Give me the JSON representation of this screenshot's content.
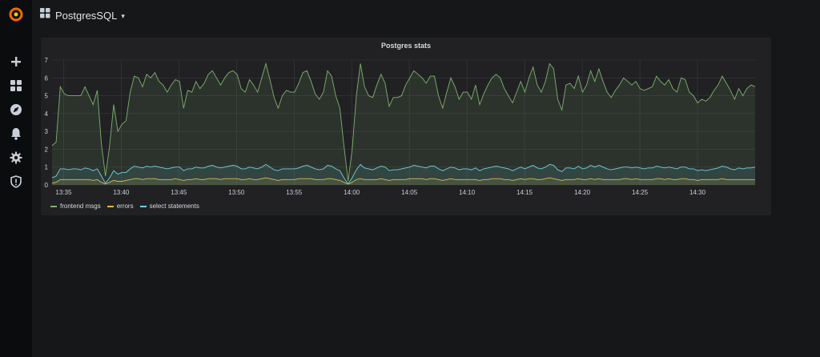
{
  "sidebar": {
    "items": [
      {
        "icon": "grafana-logo-icon"
      },
      {
        "icon": "plus-icon"
      },
      {
        "icon": "dashboards-icon"
      },
      {
        "icon": "compass-icon"
      },
      {
        "icon": "bell-icon"
      },
      {
        "icon": "gear-icon"
      },
      {
        "icon": "shield-icon"
      }
    ]
  },
  "header": {
    "dashboard_title": "PostgresSQL",
    "caret": "▾"
  },
  "panel": {
    "title": "Postgres stats"
  },
  "colors": {
    "frontend": "#7eb26d",
    "errors": "#eab839",
    "select": "#6ed0e0",
    "logo": "#f46800"
  },
  "chart_data": {
    "type": "area",
    "title": "Postgres stats",
    "xlabel": "",
    "ylabel": "",
    "ylim": [
      0,
      7
    ],
    "yticks": [
      "0",
      "1",
      "2",
      "3",
      "4",
      "5",
      "6",
      "7"
    ],
    "xticks": [
      "13:35",
      "13:40",
      "13:45",
      "13:50",
      "13:55",
      "14:00",
      "14:05",
      "14:10",
      "14:15",
      "14:20",
      "14:25",
      "14:30"
    ],
    "x_start": "13:34",
    "x_end": "14:35",
    "grid": true,
    "legend": "bottom-left",
    "series": [
      {
        "name": "frontend msgs",
        "color": "#7eb26d",
        "values": [
          2.2,
          2.4,
          5.5,
          5.1,
          5.0,
          5.0,
          5.0,
          5.0,
          5.5,
          5.0,
          4.5,
          5.3,
          2.3,
          0.5,
          2.2,
          4.5,
          3.0,
          3.4,
          3.6,
          5.2,
          6.1,
          6.0,
          5.5,
          6.2,
          6.0,
          6.3,
          5.8,
          5.6,
          5.2,
          5.6,
          5.9,
          5.8,
          4.3,
          5.3,
          5.2,
          5.8,
          5.4,
          5.7,
          6.2,
          6.4,
          6.0,
          5.6,
          6.0,
          6.3,
          6.4,
          6.2,
          5.4,
          5.2,
          5.9,
          5.6,
          5.2,
          6.0,
          6.8,
          5.9,
          4.9,
          4.3,
          5.0,
          5.3,
          5.2,
          5.2,
          5.7,
          6.3,
          6.4,
          5.8,
          5.1,
          4.8,
          5.2,
          6.4,
          6.1,
          5.0,
          4.3,
          2.2,
          0.2,
          2.0,
          5.0,
          6.8,
          5.5,
          5.0,
          4.9,
          5.6,
          6.2,
          5.7,
          4.4,
          4.9,
          4.9,
          5.0,
          5.6,
          6.0,
          6.4,
          6.2,
          6.0,
          5.7,
          6.1,
          6.1,
          5.0,
          4.3,
          5.2,
          6.0,
          5.5,
          4.8,
          5.2,
          5.2,
          4.8,
          5.6,
          4.5,
          5.1,
          5.6,
          6.0,
          6.2,
          6.0,
          5.4,
          5.0,
          4.6,
          5.2,
          5.8,
          5.2,
          6.0,
          6.6,
          5.6,
          5.2,
          5.8,
          6.8,
          6.5,
          4.8,
          4.2,
          5.6,
          5.7,
          5.4,
          6.1,
          5.2,
          5.6,
          6.4,
          5.8,
          6.5,
          5.8,
          5.2,
          4.9,
          5.3,
          5.6,
          6.0,
          5.8,
          5.6,
          5.8,
          5.4,
          5.3,
          5.4,
          5.5,
          6.1,
          5.8,
          5.6,
          5.9,
          5.4,
          5.2,
          6.0,
          5.9,
          5.2,
          5.0,
          4.6,
          4.8,
          4.7,
          4.9,
          5.3,
          5.6,
          6.1,
          5.7,
          5.3,
          4.8,
          5.4,
          5.0,
          5.4,
          5.6,
          5.5
        ]
      },
      {
        "name": "errors",
        "color": "#eab839",
        "values": [
          0.1,
          0.15,
          0.3,
          0.3,
          0.3,
          0.3,
          0.3,
          0.3,
          0.3,
          0.3,
          0.25,
          0.3,
          0.15,
          0.05,
          0.15,
          0.25,
          0.2,
          0.2,
          0.25,
          0.3,
          0.35,
          0.35,
          0.3,
          0.35,
          0.35,
          0.35,
          0.3,
          0.3,
          0.3,
          0.3,
          0.35,
          0.3,
          0.25,
          0.3,
          0.3,
          0.35,
          0.3,
          0.3,
          0.35,
          0.35,
          0.35,
          0.3,
          0.35,
          0.35,
          0.35,
          0.35,
          0.3,
          0.3,
          0.35,
          0.3,
          0.3,
          0.35,
          0.4,
          0.35,
          0.3,
          0.25,
          0.3,
          0.3,
          0.3,
          0.3,
          0.35,
          0.35,
          0.35,
          0.35,
          0.3,
          0.3,
          0.3,
          0.35,
          0.35,
          0.3,
          0.25,
          0.15,
          0.05,
          0.15,
          0.3,
          0.35,
          0.3,
          0.3,
          0.3,
          0.3,
          0.35,
          0.3,
          0.25,
          0.3,
          0.3,
          0.3,
          0.3,
          0.35,
          0.35,
          0.35,
          0.35,
          0.3,
          0.35,
          0.35,
          0.3,
          0.25,
          0.3,
          0.35,
          0.3,
          0.3,
          0.3,
          0.3,
          0.3,
          0.3,
          0.25,
          0.3,
          0.3,
          0.35,
          0.35,
          0.35,
          0.3,
          0.3,
          0.25,
          0.3,
          0.35,
          0.3,
          0.35,
          0.35,
          0.3,
          0.3,
          0.35,
          0.4,
          0.35,
          0.3,
          0.25,
          0.3,
          0.3,
          0.3,
          0.35,
          0.3,
          0.3,
          0.35,
          0.3,
          0.35,
          0.3,
          0.3,
          0.3,
          0.3,
          0.3,
          0.35,
          0.35,
          0.3,
          0.35,
          0.3,
          0.3,
          0.3,
          0.3,
          0.35,
          0.35,
          0.3,
          0.35,
          0.3,
          0.3,
          0.35,
          0.35,
          0.3,
          0.3,
          0.25,
          0.3,
          0.3,
          0.3,
          0.3,
          0.3,
          0.35,
          0.3,
          0.3,
          0.3,
          0.3,
          0.3,
          0.3,
          0.3,
          0.3
        ]
      },
      {
        "name": "select statements",
        "color": "#6ed0e0",
        "values": [
          0.4,
          0.5,
          0.9,
          0.9,
          0.85,
          0.9,
          0.9,
          0.85,
          0.95,
          0.9,
          0.8,
          0.9,
          0.5,
          0.1,
          0.4,
          0.8,
          0.6,
          0.7,
          0.7,
          0.9,
          1.05,
          1.0,
          0.95,
          1.05,
          1.0,
          1.05,
          1.0,
          0.95,
          0.9,
          0.95,
          1.0,
          1.0,
          0.8,
          0.9,
          0.9,
          1.0,
          0.95,
          0.95,
          1.05,
          1.1,
          1.0,
          0.95,
          1.0,
          1.05,
          1.1,
          1.05,
          0.9,
          0.9,
          1.0,
          0.95,
          0.9,
          1.0,
          1.15,
          1.0,
          0.85,
          0.8,
          0.9,
          0.9,
          0.9,
          0.9,
          0.95,
          1.05,
          1.1,
          1.0,
          0.9,
          0.85,
          0.9,
          1.1,
          1.05,
          0.9,
          0.8,
          0.4,
          0.05,
          0.4,
          0.85,
          1.15,
          0.95,
          0.9,
          0.85,
          0.95,
          1.05,
          1.0,
          0.8,
          0.85,
          0.85,
          0.9,
          0.95,
          1.0,
          1.1,
          1.05,
          1.0,
          0.95,
          1.05,
          1.05,
          0.9,
          0.8,
          0.9,
          1.0,
          0.95,
          0.85,
          0.9,
          0.9,
          0.85,
          0.95,
          0.8,
          0.9,
          0.95,
          1.0,
          1.05,
          1.0,
          0.95,
          0.9,
          0.8,
          0.9,
          1.0,
          0.9,
          1.0,
          1.1,
          0.95,
          0.9,
          1.0,
          1.15,
          1.1,
          0.85,
          0.75,
          0.95,
          0.95,
          0.9,
          1.05,
          0.9,
          0.95,
          1.1,
          1.0,
          1.1,
          1.0,
          0.9,
          0.85,
          0.9,
          0.95,
          1.0,
          1.0,
          0.95,
          1.0,
          0.95,
          0.9,
          0.95,
          0.95,
          1.05,
          1.0,
          0.95,
          1.0,
          0.95,
          0.9,
          1.0,
          1.0,
          0.9,
          0.9,
          0.8,
          0.85,
          0.8,
          0.85,
          0.9,
          0.95,
          1.05,
          1.0,
          0.9,
          0.85,
          0.95,
          0.9,
          0.95,
          0.95,
          1.0
        ]
      }
    ]
  }
}
